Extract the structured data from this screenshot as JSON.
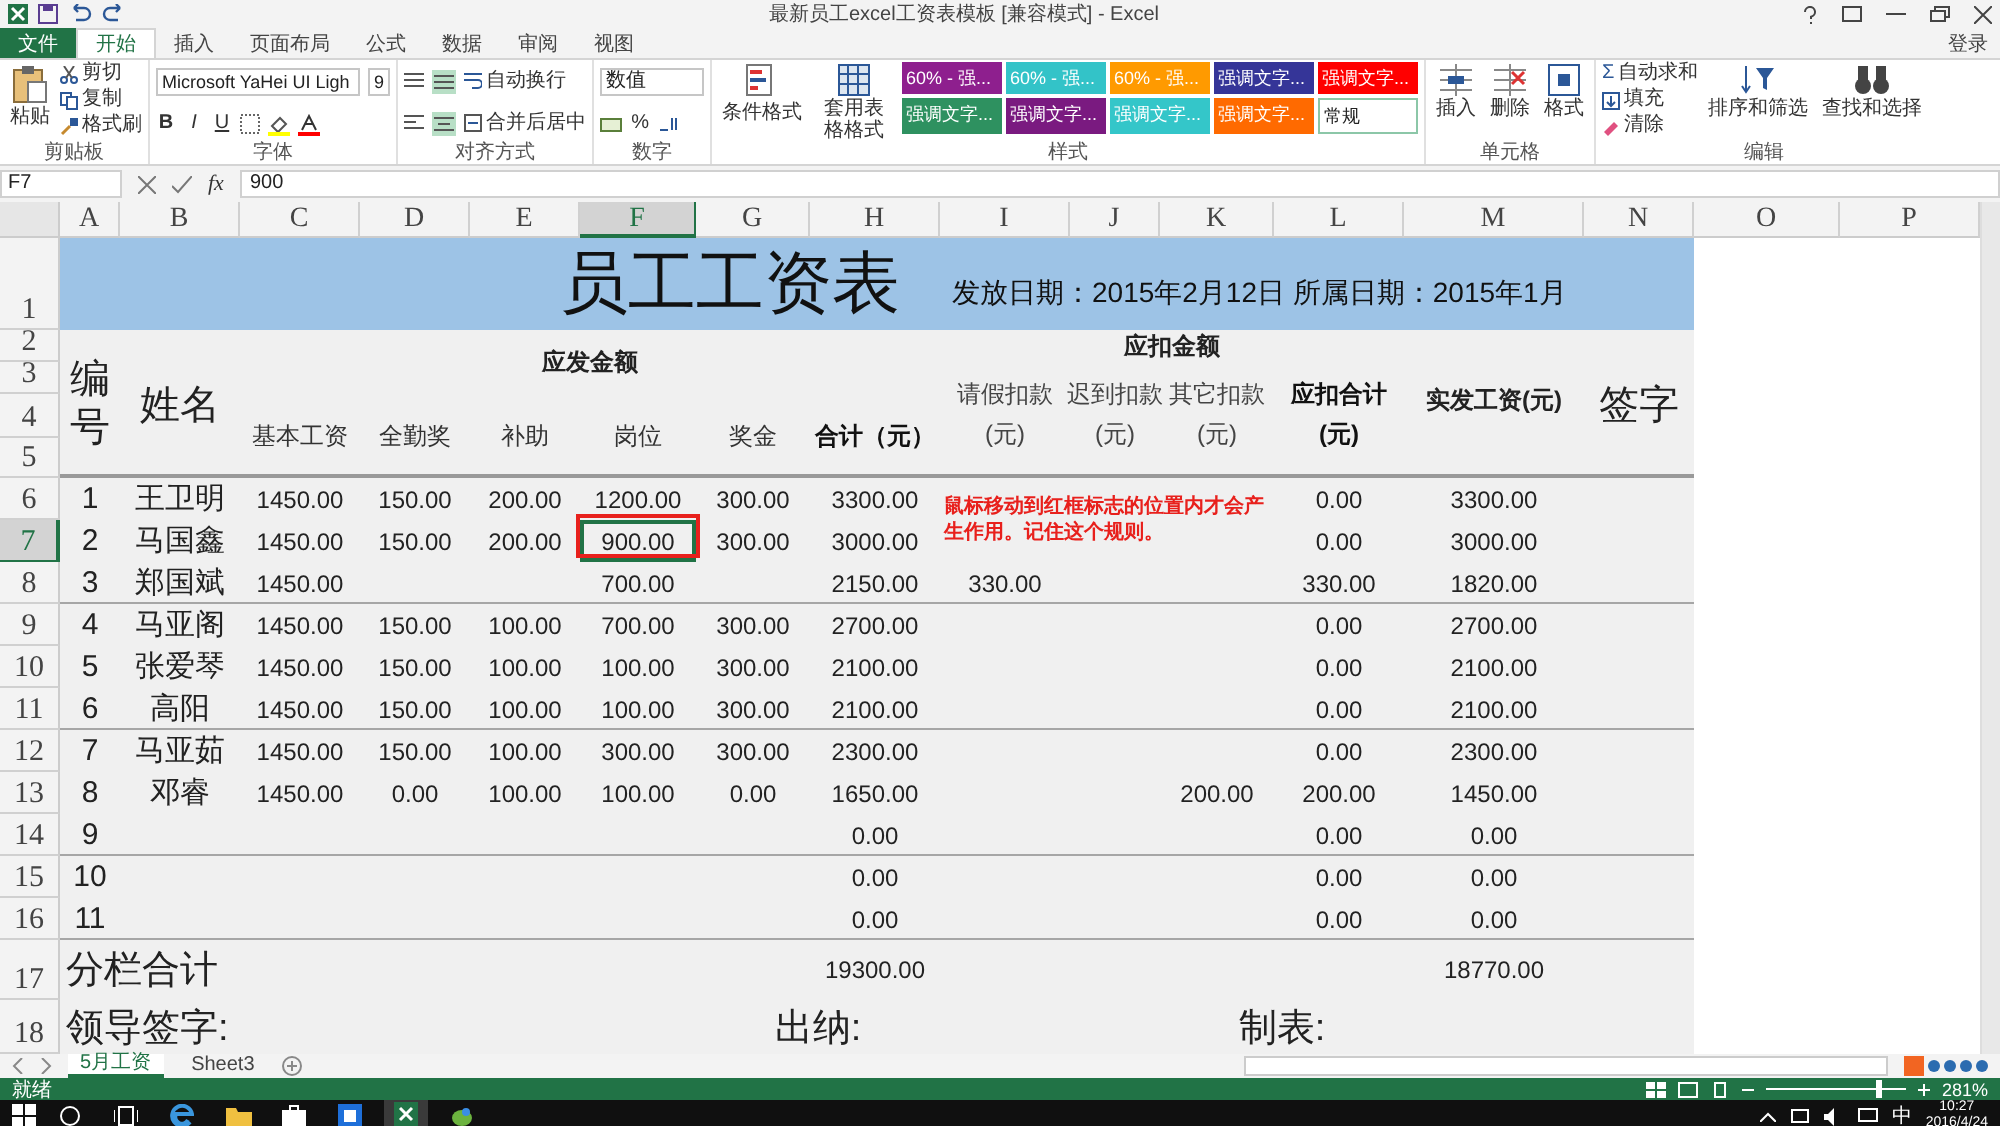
{
  "window": {
    "title": "最新员工excel工资表模板 [兼容模式] - Excel",
    "account": "登录"
  },
  "ribbon": {
    "tabs": [
      {
        "label": "文件",
        "kind": "file",
        "selected": false
      },
      {
        "label": "开始",
        "kind": "tab",
        "selected": true
      },
      {
        "label": "插入",
        "kind": "tab",
        "selected": false
      },
      {
        "label": "页面布局",
        "kind": "tab",
        "selected": false
      },
      {
        "label": "公式",
        "kind": "tab",
        "selected": false
      },
      {
        "label": "数据",
        "kind": "tab",
        "selected": false
      },
      {
        "label": "审阅",
        "kind": "tab",
        "selected": false
      },
      {
        "label": "视图",
        "kind": "tab",
        "selected": false
      }
    ],
    "clipboard": {
      "paste": "粘贴",
      "cut": "剪切",
      "copy": "复制",
      "painter": "格式刷",
      "label": "剪贴板"
    },
    "font": {
      "name": "Microsoft YaHei UI Ligh",
      "size": "9",
      "buttons": [
        "B",
        "I",
        "U"
      ],
      "label": "字体"
    },
    "alignment": {
      "wrap": "自动换行",
      "merge": "合并后居中",
      "label": "对齐方式"
    },
    "number": {
      "format": "数值",
      "percent": "%",
      "label": "数字"
    },
    "styles": {
      "conditional": "条件格式",
      "table": "套用表格格式",
      "label": "样式",
      "cells": [
        {
          "label": "60% - 强...",
          "color": "#8e1f8e"
        },
        {
          "label": "60% - 强...",
          "color": "#33c3c8"
        },
        {
          "label": "60% - 强...",
          "color": "#ff9a00"
        },
        {
          "label": "强调文字...",
          "color": "#353598"
        },
        {
          "label": "强调文字...",
          "color": "#ff0000"
        },
        {
          "label": "强调文字...",
          "color": "#2e9160"
        },
        {
          "label": "强调文字...",
          "color": "#7a1a80"
        },
        {
          "label": "强调文字...",
          "color": "#34c6c9"
        },
        {
          "label": "强调文字...",
          "color": "#ff6a00"
        },
        {
          "label": "常规",
          "color": "#ffffff"
        }
      ]
    },
    "cells": {
      "insert": "插入",
      "delete": "删除",
      "format": "格式",
      "label": "单元格"
    },
    "editing": {
      "sigma": "Σ",
      "autosum": "自动求和",
      "fill": "填充",
      "clear": "清除",
      "sort": "排序和筛选",
      "find": "查找和选择",
      "label": "编辑"
    }
  },
  "formula_bar": {
    "name_box": "F7",
    "fx": "fx",
    "value": "900"
  },
  "sheet": {
    "columns": [
      {
        "label": "A",
        "selected": false
      },
      {
        "label": "B",
        "selected": false
      },
      {
        "label": "C",
        "selected": false
      },
      {
        "label": "D",
        "selected": false
      },
      {
        "label": "E",
        "selected": false
      },
      {
        "label": "F",
        "selected": true
      },
      {
        "label": "G",
        "selected": false
      },
      {
        "label": "H",
        "selected": false
      },
      {
        "label": "I",
        "selected": false
      },
      {
        "label": "J",
        "selected": false
      },
      {
        "label": "K",
        "selected": false
      },
      {
        "label": "L",
        "selected": false
      },
      {
        "label": "M",
        "selected": false
      },
      {
        "label": "N",
        "selected": false
      },
      {
        "label": "O",
        "selected": false
      },
      {
        "label": "P",
        "selected": false
      }
    ],
    "rows": [
      {
        "label": "1",
        "selected": false
      },
      {
        "label": "2",
        "selected": false
      },
      {
        "label": "3",
        "selected": false
      },
      {
        "label": "4",
        "selected": false
      },
      {
        "label": "5",
        "selected": false
      },
      {
        "label": "6",
        "selected": false
      },
      {
        "label": "7",
        "selected": true
      },
      {
        "label": "8",
        "selected": false
      },
      {
        "label": "9",
        "selected": false
      },
      {
        "label": "10",
        "selected": false
      },
      {
        "label": "11",
        "selected": false
      },
      {
        "label": "12",
        "selected": false
      },
      {
        "label": "13",
        "selected": false
      },
      {
        "label": "14",
        "selected": false
      },
      {
        "label": "15",
        "selected": false
      },
      {
        "label": "16",
        "selected": false
      },
      {
        "label": "17",
        "selected": false
      },
      {
        "label": "18",
        "selected": false
      }
    ],
    "title": "员工工资表",
    "dates": "发放日期：2015年2月12日 所属日期：2015年1月",
    "header": {
      "number": "编号",
      "name": "姓名",
      "gross_title": "应发金额",
      "gross": [
        "基本工资",
        "全勤奖",
        "补助",
        "岗位",
        "奖金",
        "合计（元）"
      ],
      "deduct_title": "应扣金额",
      "deduct": [
        "请假扣款(元)",
        "迟到扣款(元)",
        "其它扣款(元)",
        "应扣合计(元)"
      ],
      "net": "实发工资(元)",
      "signature": "签字"
    },
    "records": [
      {
        "no": "1",
        "name": "王卫明",
        "cells": [
          "1450.00",
          "150.00",
          "200.00",
          "1200.00",
          "300.00",
          "3300.00",
          null,
          null,
          null,
          "0.00",
          "3300.00"
        ]
      },
      {
        "no": "2",
        "name": "马国鑫",
        "cells": [
          "1450.00",
          "150.00",
          "200.00",
          "900.00",
          "300.00",
          "3000.00",
          null,
          null,
          null,
          "0.00",
          "3000.00"
        ]
      },
      {
        "no": "3",
        "name": "郑国斌",
        "cells": [
          "1450.00",
          null,
          null,
          "700.00",
          null,
          "2150.00",
          "330.00",
          null,
          null,
          "330.00",
          "1820.00"
        ]
      },
      {
        "no": "4",
        "name": "马亚阁",
        "cells": [
          "1450.00",
          "150.00",
          "100.00",
          "700.00",
          "300.00",
          "2700.00",
          null,
          null,
          null,
          "0.00",
          "2700.00"
        ]
      },
      {
        "no": "5",
        "name": "张爱琴",
        "cells": [
          "1450.00",
          "150.00",
          "100.00",
          "100.00",
          "300.00",
          "2100.00",
          null,
          null,
          null,
          "0.00",
          "2100.00"
        ]
      },
      {
        "no": "6",
        "name": "高阳",
        "cells": [
          "1450.00",
          "150.00",
          "100.00",
          "100.00",
          "300.00",
          "2100.00",
          null,
          null,
          null,
          "0.00",
          "2100.00"
        ]
      },
      {
        "no": "7",
        "name": "马亚茹",
        "cells": [
          "1450.00",
          "150.00",
          "100.00",
          "300.00",
          "300.00",
          "2300.00",
          null,
          null,
          null,
          "0.00",
          "2300.00"
        ]
      },
      {
        "no": "8",
        "name": "邓睿",
        "cells": [
          "1450.00",
          "0.00",
          "100.00",
          "100.00",
          "0.00",
          "1650.00",
          null,
          null,
          "200.00",
          "200.00",
          "1450.00"
        ]
      },
      {
        "no": "9",
        "cells": [
          null,
          null,
          null,
          null,
          null,
          "0.00",
          null,
          null,
          null,
          "0.00",
          "0.00"
        ]
      },
      {
        "no": "10",
        "cells": [
          null,
          null,
          null,
          null,
          null,
          "0.00",
          null,
          null,
          null,
          "0.00",
          "0.00"
        ]
      },
      {
        "no": "11",
        "cells": [
          null,
          null,
          null,
          null,
          null,
          "0.00",
          null,
          null,
          null,
          "0.00",
          "0.00"
        ]
      }
    ],
    "subtotal": {
      "label": "分栏合计",
      "gross_total": "19300.00",
      "net_total": "18770.00"
    },
    "signoff": {
      "leader": "领导签字:",
      "cashier": "出纳:",
      "preparer": "制表:"
    },
    "annotation": "鼠标移动到红框标志的位置内才会产生作用。记住这个规则。"
  },
  "sheet_tabs": [
    {
      "label": "5月工资",
      "selected": true
    },
    {
      "label": "Sheet3",
      "selected": false
    }
  ],
  "status_bar": {
    "state": "就绪",
    "zoom": "281%",
    "zoom_level": {
      "level": 0.8
    }
  },
  "taskbar": {
    "apps": [
      {
        "kind": "search",
        "selected": false
      },
      {
        "kind": "taskview",
        "selected": false
      },
      {
        "kind": "edge",
        "selected": false
      },
      {
        "kind": "folder",
        "selected": false
      },
      {
        "kind": "store",
        "selected": false
      },
      {
        "kind": "media",
        "selected": false
      },
      {
        "kind": "excel",
        "selected": true
      },
      {
        "kind": "bird",
        "selected": false
      }
    ],
    "ime": "中",
    "time": "10:27",
    "date": "2016/4/24"
  }
}
